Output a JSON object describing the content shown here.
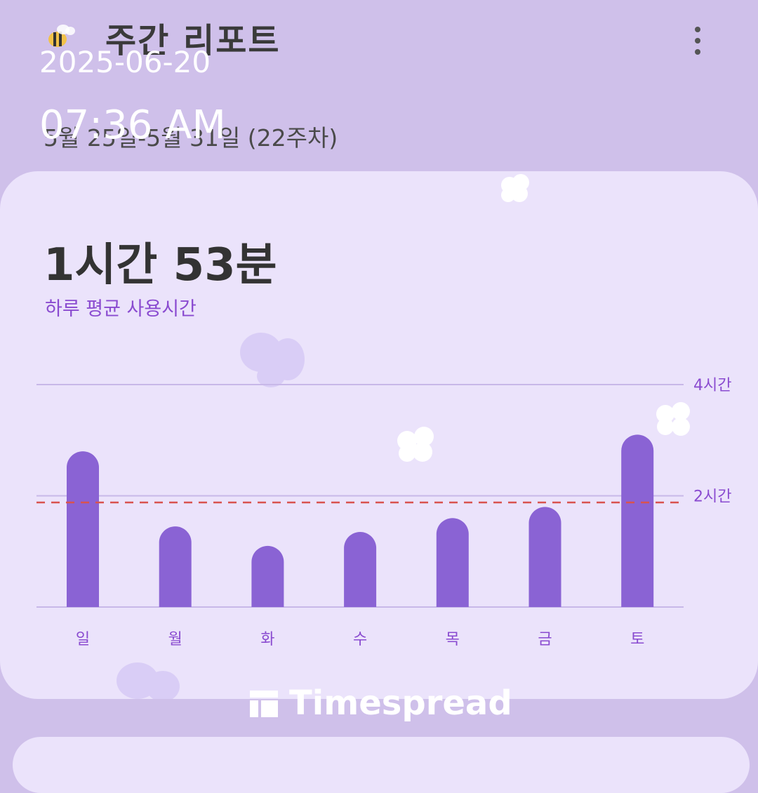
{
  "header": {
    "title": "주간 리포트",
    "date_range": "5월 25일-5월 31일 (22주차)",
    "menu_icon": "more-vertical-icon"
  },
  "overlay": {
    "date": "2025-06-20",
    "time": "07:36 AM"
  },
  "summary": {
    "total": "1시간 53분",
    "subtitle": "하루 평균 사용시간"
  },
  "colors": {
    "background": "#cfc0ea",
    "card": "#ebe3fb",
    "bar": "#8a63d4",
    "average_line": "#d9534f",
    "accent_text": "#8a4bd0"
  },
  "chart_data": {
    "type": "bar",
    "categories": [
      "일",
      "월",
      "화",
      "수",
      "목",
      "금",
      "토"
    ],
    "values": [
      2.8,
      1.45,
      1.1,
      1.35,
      1.6,
      1.8,
      3.1
    ],
    "average": 1.88,
    "ylim": [
      0,
      4
    ],
    "yticks": [
      {
        "value": 4,
        "label": "4시간"
      },
      {
        "value": 2,
        "label": "2시간"
      }
    ],
    "grid": true
  },
  "watermark": {
    "text": "Timespread",
    "icon": "timespread-logo-icon"
  }
}
